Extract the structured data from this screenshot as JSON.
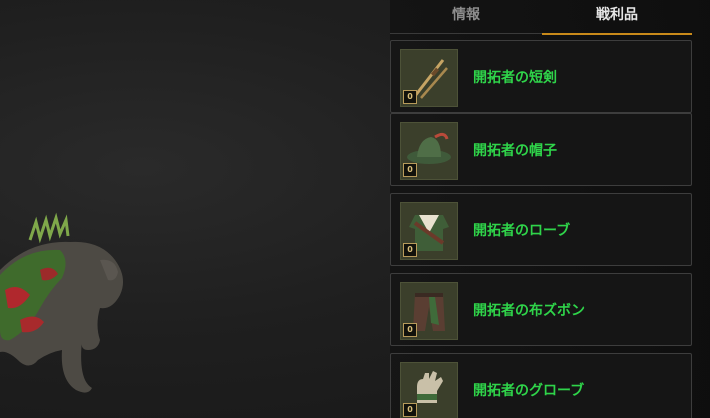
{
  "tabs": [
    {
      "label": "情報",
      "active": false
    },
    {
      "label": "戦利品",
      "active": true
    }
  ],
  "loot_items": [
    {
      "name": "開拓者の短剣",
      "grade": "0",
      "icon": "dagger-icon"
    },
    {
      "name": "開拓者の帽子",
      "grade": "0",
      "icon": "hat-icon"
    },
    {
      "name": "開拓者のローブ",
      "grade": "0",
      "icon": "robe-icon"
    },
    {
      "name": "開拓者の布ズボン",
      "grade": "0",
      "icon": "pants-icon"
    },
    {
      "name": "開拓者のグローブ",
      "grade": "0",
      "icon": "glove-icon"
    }
  ],
  "colors": {
    "item_name": "#2fd44a",
    "tab_active_underline": "#c98a1a",
    "tab_inactive": "#8c8c8c",
    "tab_active": "#e6e6e6"
  }
}
